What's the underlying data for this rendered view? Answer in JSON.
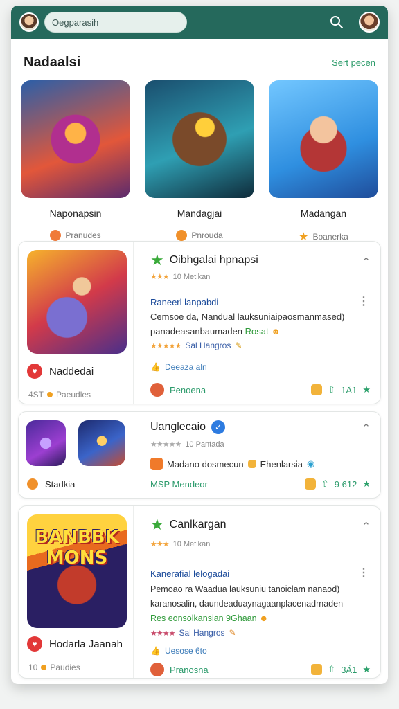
{
  "topbar": {
    "search_value": "Oegparasih",
    "colors": {
      "bar": "#25695c",
      "accent": "#2c9b6a"
    }
  },
  "section": {
    "title": "Nadaalsi",
    "see_all": "Sert pecen"
  },
  "featured": [
    {
      "name": "Naponapsin",
      "sub": "Pranudes",
      "icon": "heart-icon"
    },
    {
      "name": "Mandagjai",
      "sub": "Pnrouda",
      "icon": "heart-icon"
    },
    {
      "name": "Madangan",
      "sub": "Boanerka",
      "icon": "star-icon"
    }
  ],
  "cards": [
    {
      "left_title": "Naddedai",
      "left_meta_count": "4ST",
      "left_meta_label": "Paeudles",
      "title": "Oibhgalai hpnapsi",
      "rating_text": "10 Metikan",
      "link": "Raneerl lanpabdi",
      "desc_line1": "Cemsoe da, Nandual lauksuniaipaosmanmased)",
      "desc_line2": "panadeasanbaumaden",
      "desc_green": "Rosat",
      "tags": "Sal Hangros",
      "small": "Deeaza aln",
      "foot_left": "Penoena",
      "foot_right": "1Ä1"
    },
    {
      "title": "Uanglecaio",
      "rating_text": "10 Pantada",
      "line": "Madano dosmecun",
      "line_tail": "Ehenlarsia",
      "left_title": "Stadkia",
      "foot_left": "MSP Mendeor",
      "foot_right": "9 612"
    },
    {
      "left_title": "Hodarla Jaanah",
      "left_meta_count": "10",
      "left_meta_label": "Paudies",
      "logo": "BANBBK MONS",
      "title": "Canlkargan",
      "rating_text": "10 Metikan",
      "link": "Kanerafial lelogadai",
      "desc_line1": "Pemoao ra  Waadua lauksuniu tanoiclam nanaod)",
      "desc_line2": "karanosalin, daundeaduaynagaanplacenadrnaden",
      "desc_green": "Res eonsolkansian 9Ghaan",
      "tags": "Sal Hangros",
      "small": "Uesose 6to",
      "foot_left": "Pranosna",
      "foot_right": "3Ä1"
    }
  ]
}
